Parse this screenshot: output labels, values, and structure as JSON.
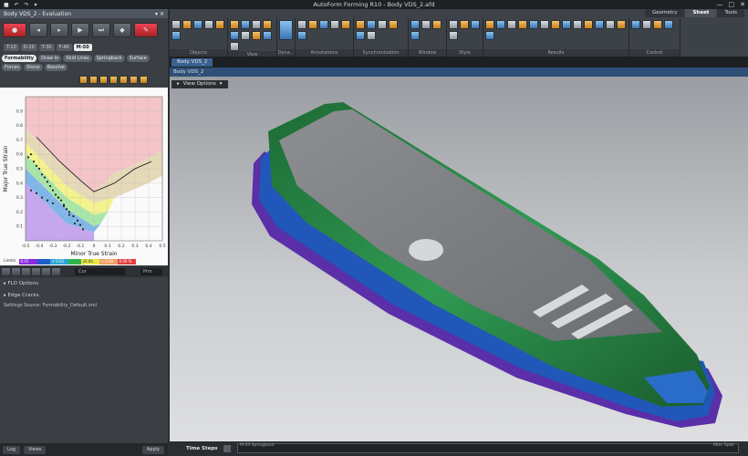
{
  "app_title": "AutoForm Forming R10 - Body VDS_2.afd",
  "quick_access": "■ ↶ ↷ ▾",
  "window_controls": {
    "min": "—",
    "max": "□",
    "close": "✕"
  },
  "left_panel": {
    "title": "Body VDS_2 - Evaluation",
    "steps": [
      "T-10",
      "D-20",
      "T-30",
      "F-40",
      "M-50"
    ],
    "active_step": "M-50",
    "tabs": [
      "Formability",
      "Draw In",
      "Skid Lines",
      "Springback",
      "Surface",
      "Forces",
      "Stone",
      "Resolve"
    ],
    "active_tab": "Formability",
    "fld_tabs": [
      "Advanced FLD",
      "Surface Failure"
    ],
    "active_fld_tab": "Advanced FLD",
    "legend_label": "Limits",
    "legend_cells": [
      {
        "text": "0.01",
        "color": "#8a2be2"
      },
      {
        "text": "",
        "color": "#1f5fc8"
      },
      {
        "text": "< 0.02",
        "color": "#2aa6d6"
      },
      {
        "text": "",
        "color": "#2fb34a"
      },
      {
        "text": "20.00 %",
        "color": "#e8e84a"
      },
      {
        "text": "> 0.30",
        "color": "#f0a060"
      },
      {
        "text": "0.00 %",
        "color": "#e24040"
      }
    ],
    "bottom_select": "Cur",
    "bottom_select2": "Prm",
    "options": [
      {
        "label": "FLD Options"
      },
      {
        "label": "Edge Cracks"
      }
    ],
    "settings_source": "Settings Source:  Formability_Default.xml",
    "footer": {
      "log": "Log",
      "views": "Views",
      "apply": "Apply"
    }
  },
  "chart_data": {
    "type": "scatter",
    "xlabel": "Minor True Strain",
    "ylabel": "Major True Strain",
    "xlim": [
      -0.5,
      0.5
    ],
    "ylim": [
      0,
      1.0
    ],
    "x_ticks": [
      "-0.5",
      "-0.4",
      "-0.3",
      "-0.2",
      "-0.1",
      "0",
      "0.1",
      "0.2",
      "0.3",
      "0.4",
      "0.5"
    ],
    "y_ticks": [
      "0.1",
      "0.2",
      "0.3",
      "0.4",
      "0.5",
      "0.6",
      "0.7",
      "0.8",
      "0.9"
    ],
    "flc_curve": {
      "x": [
        -0.42,
        -0.25,
        -0.1,
        0.0,
        0.15,
        0.3,
        0.42
      ],
      "y": [
        0.72,
        0.55,
        0.42,
        0.34,
        0.4,
        0.5,
        0.55
      ]
    },
    "points": {
      "x": [
        -0.48,
        -0.46,
        -0.44,
        -0.42,
        -0.4,
        -0.38,
        -0.36,
        -0.34,
        -0.32,
        -0.3,
        -0.28,
        -0.26,
        -0.24,
        -0.22,
        -0.2,
        -0.18,
        -0.15,
        -0.12,
        -0.1,
        -0.08,
        -0.46,
        -0.42,
        -0.38,
        -0.34,
        -0.3,
        -0.26,
        -0.22,
        -0.18,
        -0.14
      ],
      "y": [
        0.58,
        0.6,
        0.55,
        0.52,
        0.5,
        0.46,
        0.44,
        0.41,
        0.38,
        0.35,
        0.32,
        0.3,
        0.28,
        0.25,
        0.22,
        0.2,
        0.17,
        0.14,
        0.11,
        0.08,
        0.35,
        0.33,
        0.3,
        0.28,
        0.26,
        0.3,
        0.24,
        0.18,
        0.12
      ]
    }
  },
  "ribbon": {
    "tabs": [
      "Geometry",
      "Sheet",
      "Tools"
    ],
    "active_tab": "Sheet",
    "groups": [
      {
        "label": "Objects",
        "n": 6
      },
      {
        "label": "View",
        "n": 9
      },
      {
        "label": "Dyna...",
        "n": 1
      },
      {
        "label": "Annotations",
        "n": 6
      },
      {
        "label": "Synchronization",
        "n": 6
      },
      {
        "label": "Window",
        "n": 4
      },
      {
        "label": "Style",
        "n": 4
      },
      {
        "label": "Results",
        "n": 14
      },
      {
        "label": "Control",
        "n": 4
      }
    ]
  },
  "viewport": {
    "doc_tab": "Body VDS_2",
    "sub_title": "Body VDS_2",
    "view_options": "View Options",
    "time_steps": "Time Steps",
    "track_left": "M-50 Springback",
    "track_right": "After Spbk"
  }
}
